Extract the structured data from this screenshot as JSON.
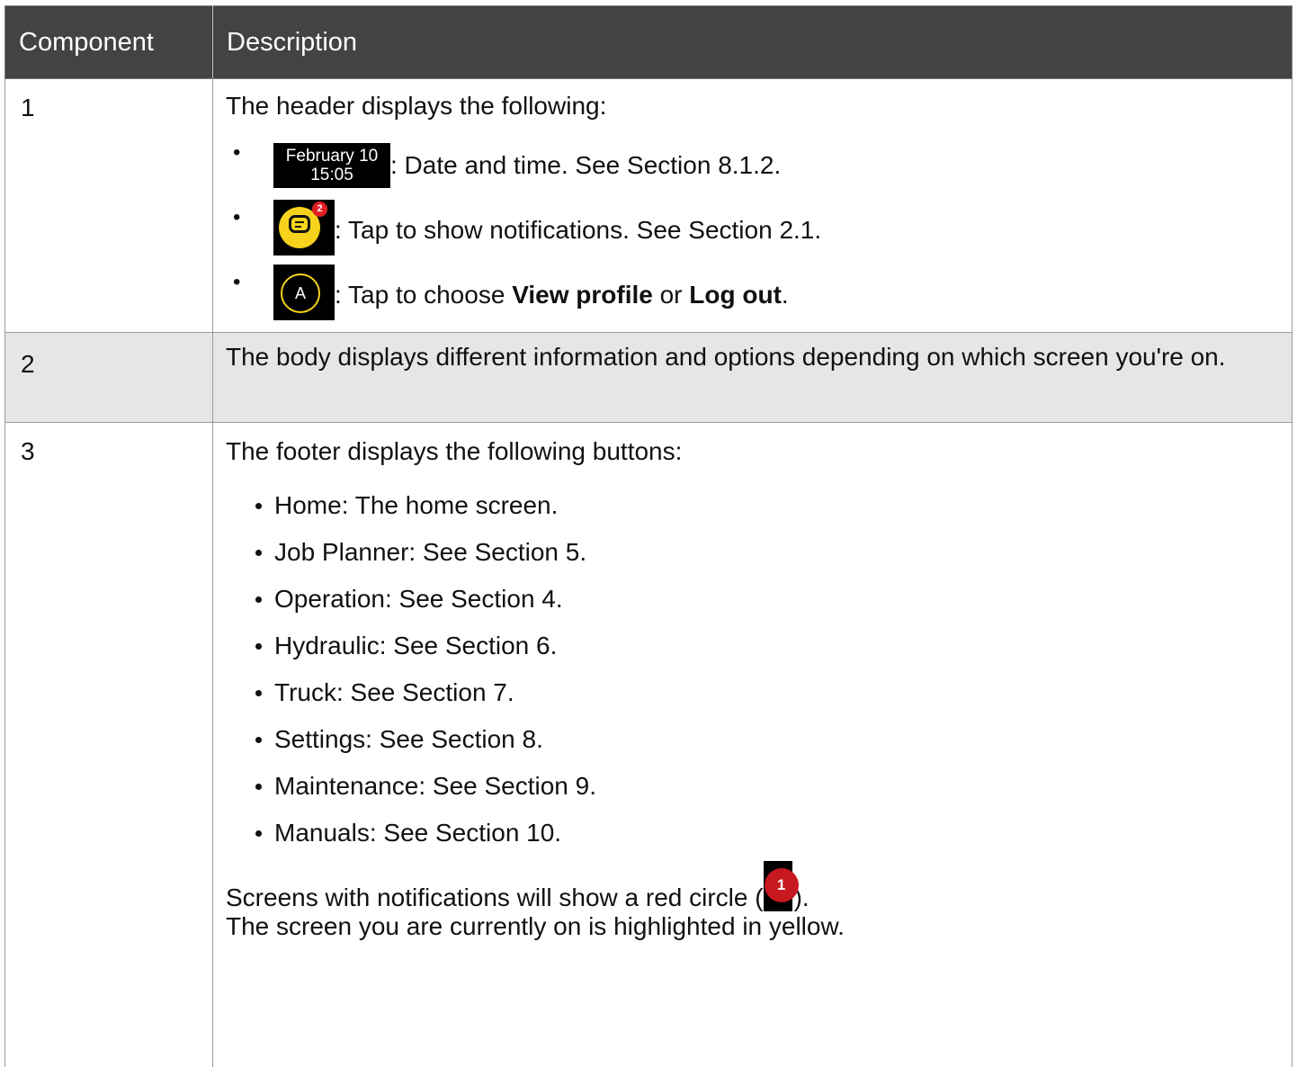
{
  "table": {
    "headers": [
      "Component",
      "Description"
    ],
    "rows": [
      {
        "component": "1",
        "intro": "The header displays the following:",
        "items": [
          {
            "icon": "date-time-icon",
            "icon_text_month": "February 10",
            "icon_text_time": "15:05",
            "text": ": Date and time. See Section 8.1.2."
          },
          {
            "icon": "notifications-icon",
            "badge": "2",
            "text": ": Tap to show notifications. See Section 2.1."
          },
          {
            "icon": "profile-avatar-icon",
            "avatar_letter": "A",
            "text_before": ": Tap to choose ",
            "bold1": "View profile",
            "text_middle": " or ",
            "bold2": "Log out",
            "text_after": "."
          }
        ]
      },
      {
        "component": "2",
        "description": "The body displays different information and options depending on which screen you're on."
      },
      {
        "component": "3",
        "intro": "The footer displays the following buttons:",
        "buttons": [
          "Home: The home screen.",
          "Job Planner: See Section 5.",
          "Operation: See Section 4.",
          "Hydraulic: See Section 6.",
          "Truck: See Section 7.",
          "Settings: See Section 8.",
          "Maintenance: See Section 9.",
          "Manuals: See Section 10."
        ],
        "note_before": "Screens with notifications will show a red circle (",
        "note_badge": "1",
        "note_after": ").",
        "note_line2": "The screen you are currently on is highlighted in yellow."
      }
    ]
  },
  "colors": {
    "header_bg": "#434345",
    "row_highlight": "#e6e6e8",
    "accent_yellow": "#f6d21c",
    "badge_red": "#e01e23"
  }
}
